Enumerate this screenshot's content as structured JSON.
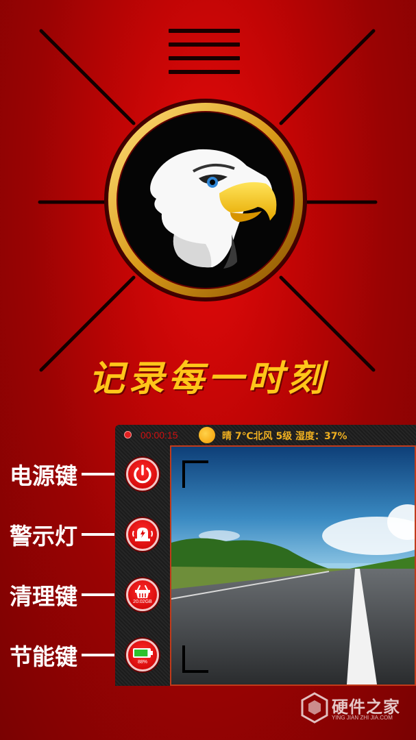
{
  "app": {
    "slogan": "记录每一时刻",
    "emblem_icon": "eagle-head-icon",
    "menu_icon": "hamburger-menu-icon",
    "accent_color": "#ffc61a",
    "background_color": "#c20505"
  },
  "status_bar": {
    "recording_time": "00:00:15",
    "weather_icon": "sun-icon",
    "weather_text": "晴 7℃北风 5级 湿度：37%"
  },
  "controls": [
    {
      "label": "电源键",
      "icon": "power-icon"
    },
    {
      "label": "警示灯",
      "icon": "warning-light-icon"
    },
    {
      "label": "清理键",
      "icon": "cleanup-basket-icon",
      "sub": "20.02GB"
    },
    {
      "label": "节能键",
      "icon": "battery-icon",
      "sub": "88%",
      "level": 0.88
    }
  ],
  "watermark": {
    "main": "硬件之家",
    "sub": "YING JIAN ZHI JIA.COM"
  }
}
